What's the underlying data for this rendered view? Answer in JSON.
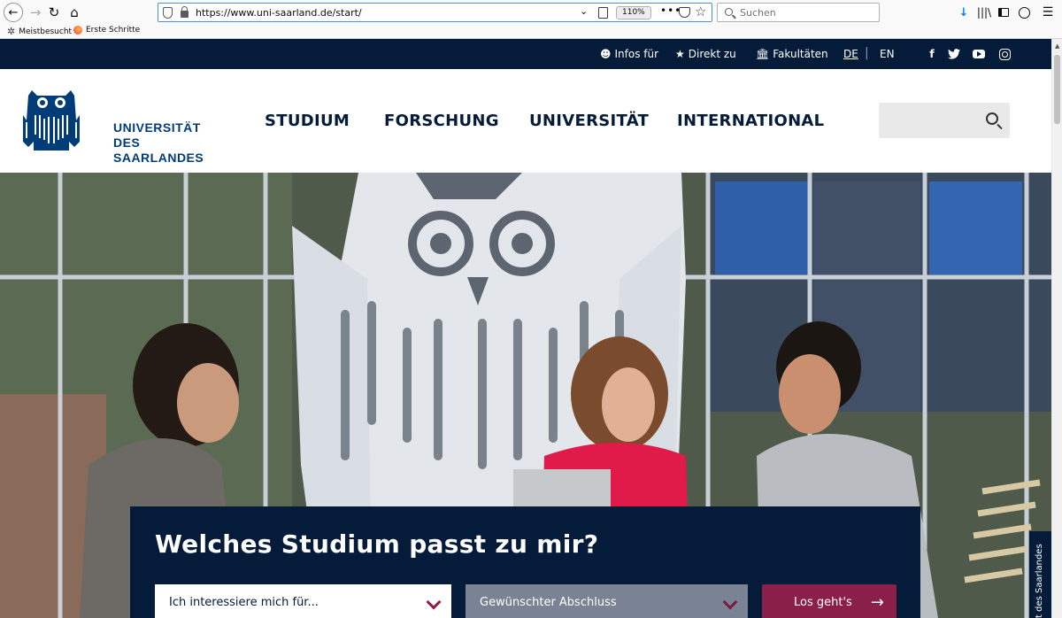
{
  "browser": {
    "url": "https://www.uni-saarland.de/start/",
    "zoom": "110%",
    "search_placeholder": "Suchen",
    "bookmarks": [
      "Meistbesucht",
      "Erste Schritte"
    ]
  },
  "topbar": {
    "infos": "Infos für",
    "direkt": "Direkt zu",
    "fakultaeten": "Fakultäten",
    "lang_de": "DE",
    "lang_sep": "|",
    "lang_en": "EN",
    "social": [
      "facebook-icon",
      "twitter-icon",
      "youtube-icon",
      "instagram-icon"
    ]
  },
  "logo": {
    "line1": "UNIVERSITÄT",
    "line2": "DES",
    "line3": "SAARLANDES"
  },
  "mainnav": [
    "STUDIUM",
    "FORSCHUNG",
    "UNIVERSITÄT",
    "INTERNATIONAL"
  ],
  "finder": {
    "title": "Welches Studium passt zu mir?",
    "interest": "Ich interessiere mich für...",
    "degree": "Gewünschter Abschluss",
    "submit": "Los geht's"
  },
  "side_tab": "t des Saarlandes",
  "colors": {
    "navy": "#041b3a",
    "logo_blue": "#003c78",
    "accent": "#8a1f4a"
  }
}
